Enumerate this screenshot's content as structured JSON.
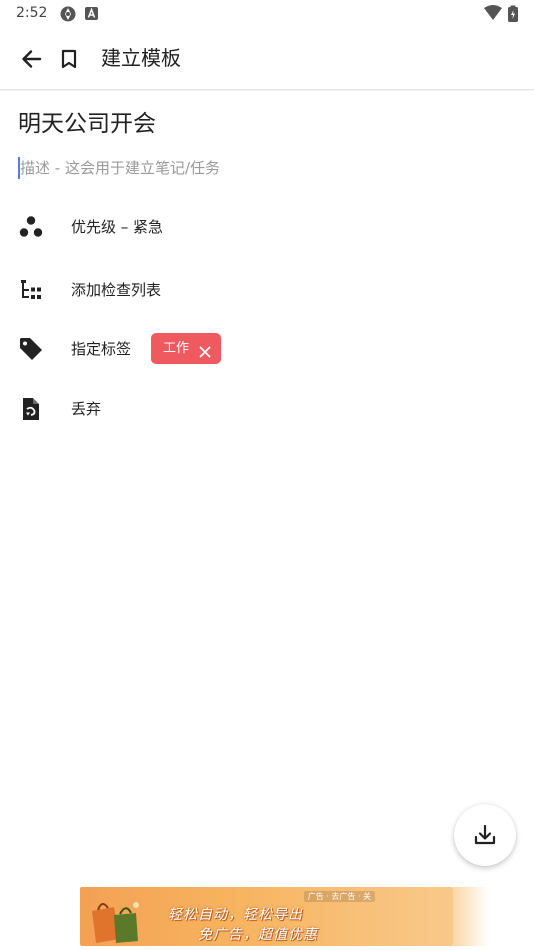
{
  "status_bar": {
    "time": "2:52",
    "icons": [
      "app-notification-icon",
      "a-notification-icon",
      "wifi-icon",
      "battery-icon"
    ]
  },
  "app_bar": {
    "title": "建立模板",
    "back_icon": "arrow-left-icon",
    "bookmark_icon": "bookmark-icon"
  },
  "template": {
    "title": "明天公司开会",
    "description_placeholder": "描述 - 这会用于建立笔记/任务",
    "options": [
      {
        "icon": "priority-icon",
        "label": "优先级 – 紧急"
      },
      {
        "icon": "checklist-icon",
        "label": "添加检查列表"
      },
      {
        "icon": "tag-icon",
        "label": "指定标签"
      },
      {
        "icon": "discard-icon",
        "label": "丢弃"
      }
    ],
    "tags": [
      {
        "label": "工作",
        "color": "#ee5a5f"
      }
    ]
  },
  "fab": {
    "icon": "download-icon"
  },
  "ad": {
    "tag": "广告 · 去广告 · 关",
    "line1": "轻松自动，轻松导出",
    "line2": "免广告，超值优惠"
  },
  "colors": {
    "accent_tag": "#ee5a5f",
    "cursor": "#5b7fd6",
    "placeholder": "#9a9a9a"
  }
}
